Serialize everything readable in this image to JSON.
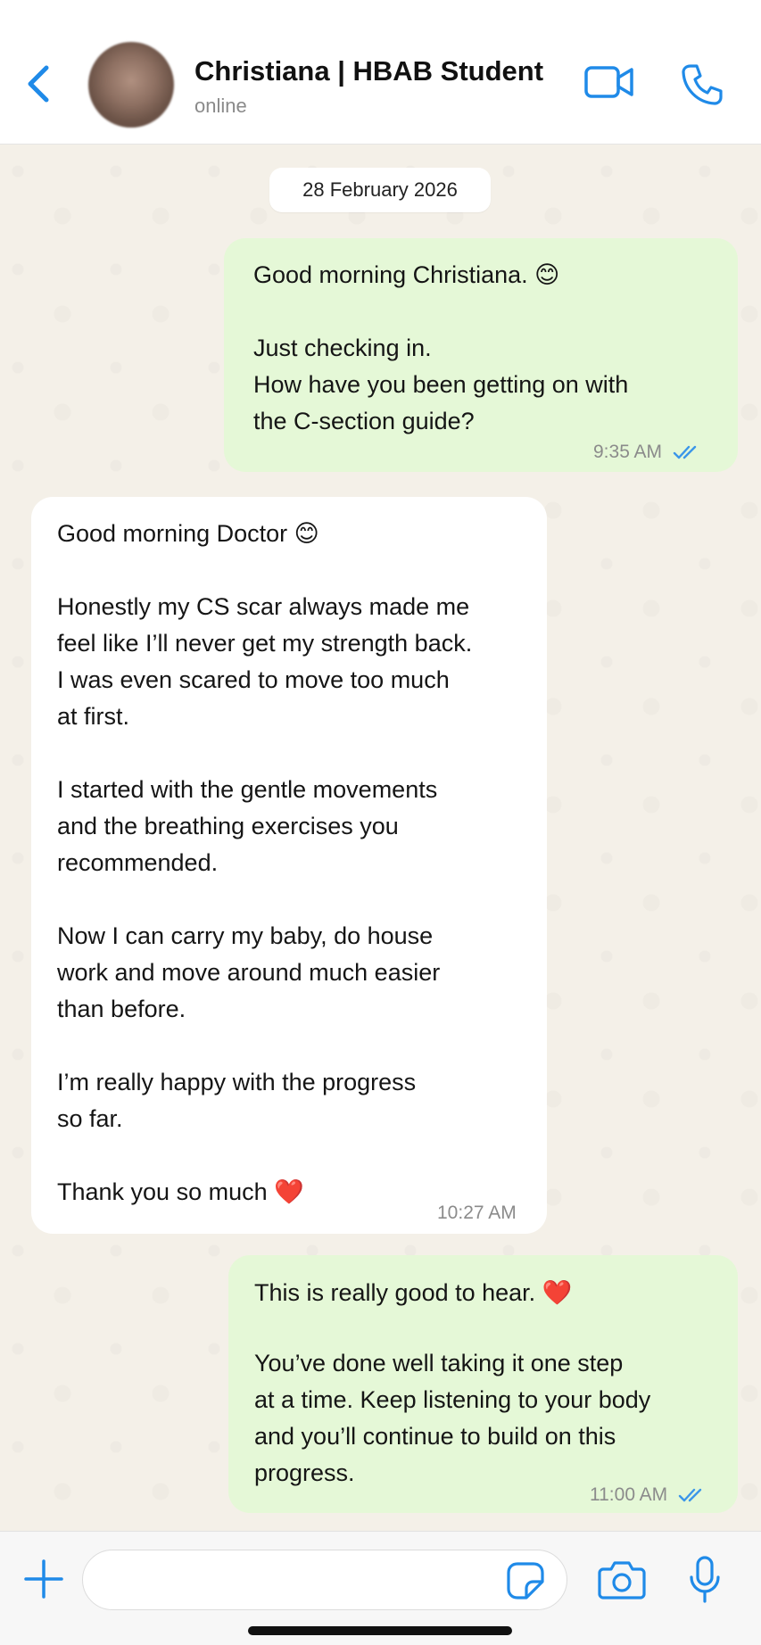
{
  "header": {
    "contact_name": "Christiana | HBAB Student",
    "status": "online",
    "icons": [
      "back-chevron-icon",
      "avatar",
      "video-camera-icon",
      "phone-icon"
    ]
  },
  "chat": {
    "date_chip": "28 February 2026",
    "messages": [
      {
        "direction": "outgoing",
        "lines": [
          "Good morning Christiana. 😊",
          "",
          "Just checking in.",
          "How have you been getting on with",
          "the C-section guide?"
        ],
        "time": "9:35 AM",
        "read": true
      },
      {
        "direction": "incoming",
        "lines": [
          "Good morning Doctor 😊",
          "",
          "Honestly my CS scar always made me",
          "feel like I’ll never get my strength back.",
          "I was even scared to move too much",
          "at first.",
          "",
          "I started with the gentle movements",
          "and the breathing exercises you",
          "recommended.",
          "",
          "Now I can carry my baby, do house",
          "work and move around much easier",
          "than before.",
          "",
          "I’m really happy with the progress",
          "so far.",
          "",
          "Thank you so much ❤️"
        ],
        "time": "10:27 AM"
      },
      {
        "direction": "outgoing",
        "lines": [
          "This is really good to hear. ❤️",
          "",
          "You’ve done well taking it one step",
          "at a time. Keep listening to your body",
          "and you’ll continue to build on this",
          "progress."
        ],
        "time": "11:00 AM",
        "read": true
      }
    ]
  },
  "composer": {
    "placeholder": "",
    "value": "",
    "icons": [
      "plus-icon",
      "sticker-icon",
      "camera-icon",
      "microphone-icon"
    ]
  },
  "colors": {
    "accent": "#1f8ae8",
    "outgoing_bubble": "#e5f8d7",
    "incoming_bubble": "#ffffff",
    "chat_background": "#f4f0e8",
    "read_ticks": "#3b96e9"
  }
}
